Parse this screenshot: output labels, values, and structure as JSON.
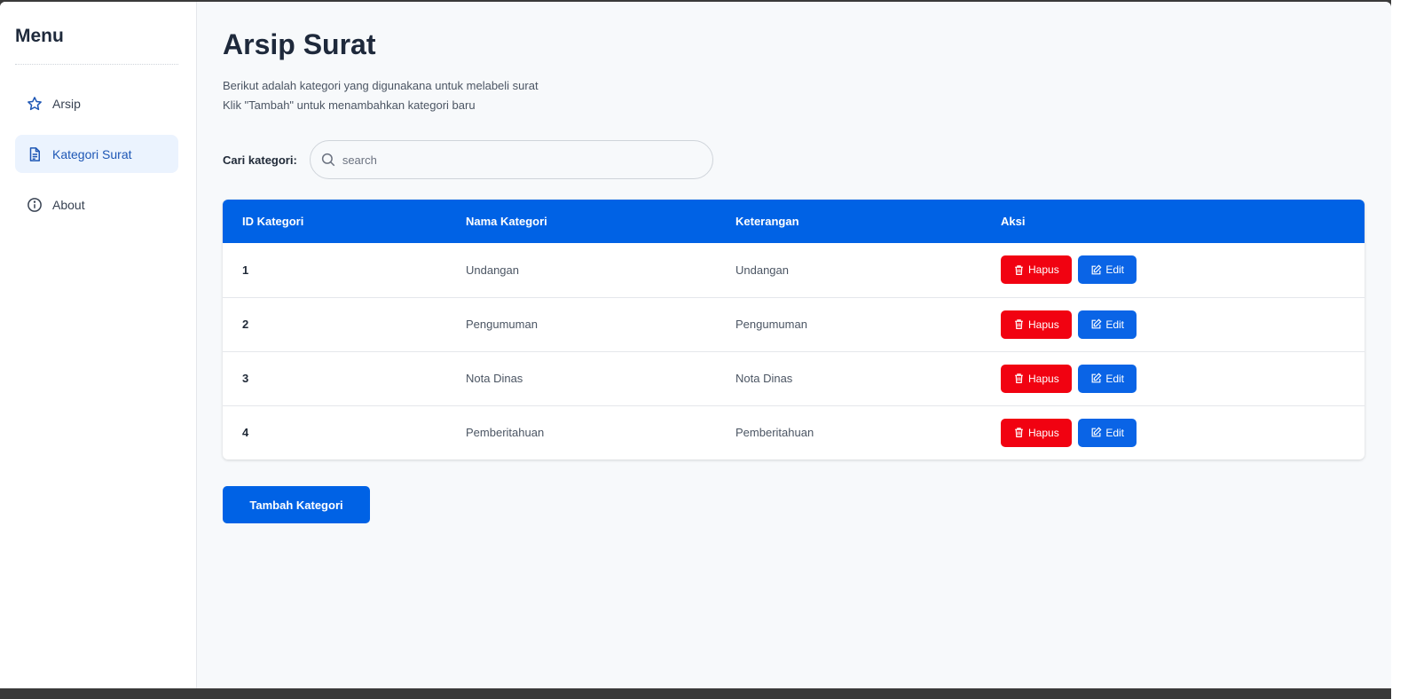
{
  "sidebar": {
    "title": "Menu",
    "items": [
      {
        "label": "Arsip",
        "icon": "star-icon",
        "active": false
      },
      {
        "label": "Kategori Surat",
        "icon": "document-icon",
        "active": true
      },
      {
        "label": "About",
        "icon": "info-icon",
        "active": false
      }
    ]
  },
  "main": {
    "title": "Arsip Surat",
    "description_line1": "Berikut adalah kategori yang digunakana untuk melabeli surat",
    "description_line2": "Klik \"Tambah\" untuk menambahkan kategori baru",
    "search_label": "Cari kategori:",
    "search_placeholder": "search",
    "search_value": ""
  },
  "table": {
    "headers": [
      "ID Kategori",
      "Nama Kategori",
      "Keterangan",
      "Aksi"
    ],
    "rows": [
      {
        "id": "1",
        "name": "Undangan",
        "note": "Undangan"
      },
      {
        "id": "2",
        "name": "Pengumuman",
        "note": "Pengumuman"
      },
      {
        "id": "3",
        "name": "Nota Dinas",
        "note": "Nota Dinas"
      },
      {
        "id": "4",
        "name": "Pemberitahuan",
        "note": "Pemberitahuan"
      }
    ],
    "delete_label": "Hapus",
    "edit_label": "Edit"
  },
  "add_button_label": "Tambah Kategori",
  "colors": {
    "primary": "#0062e5",
    "danger": "#f10211",
    "active_nav_bg": "#ebf3fe",
    "active_nav_text": "#1e57b5"
  }
}
